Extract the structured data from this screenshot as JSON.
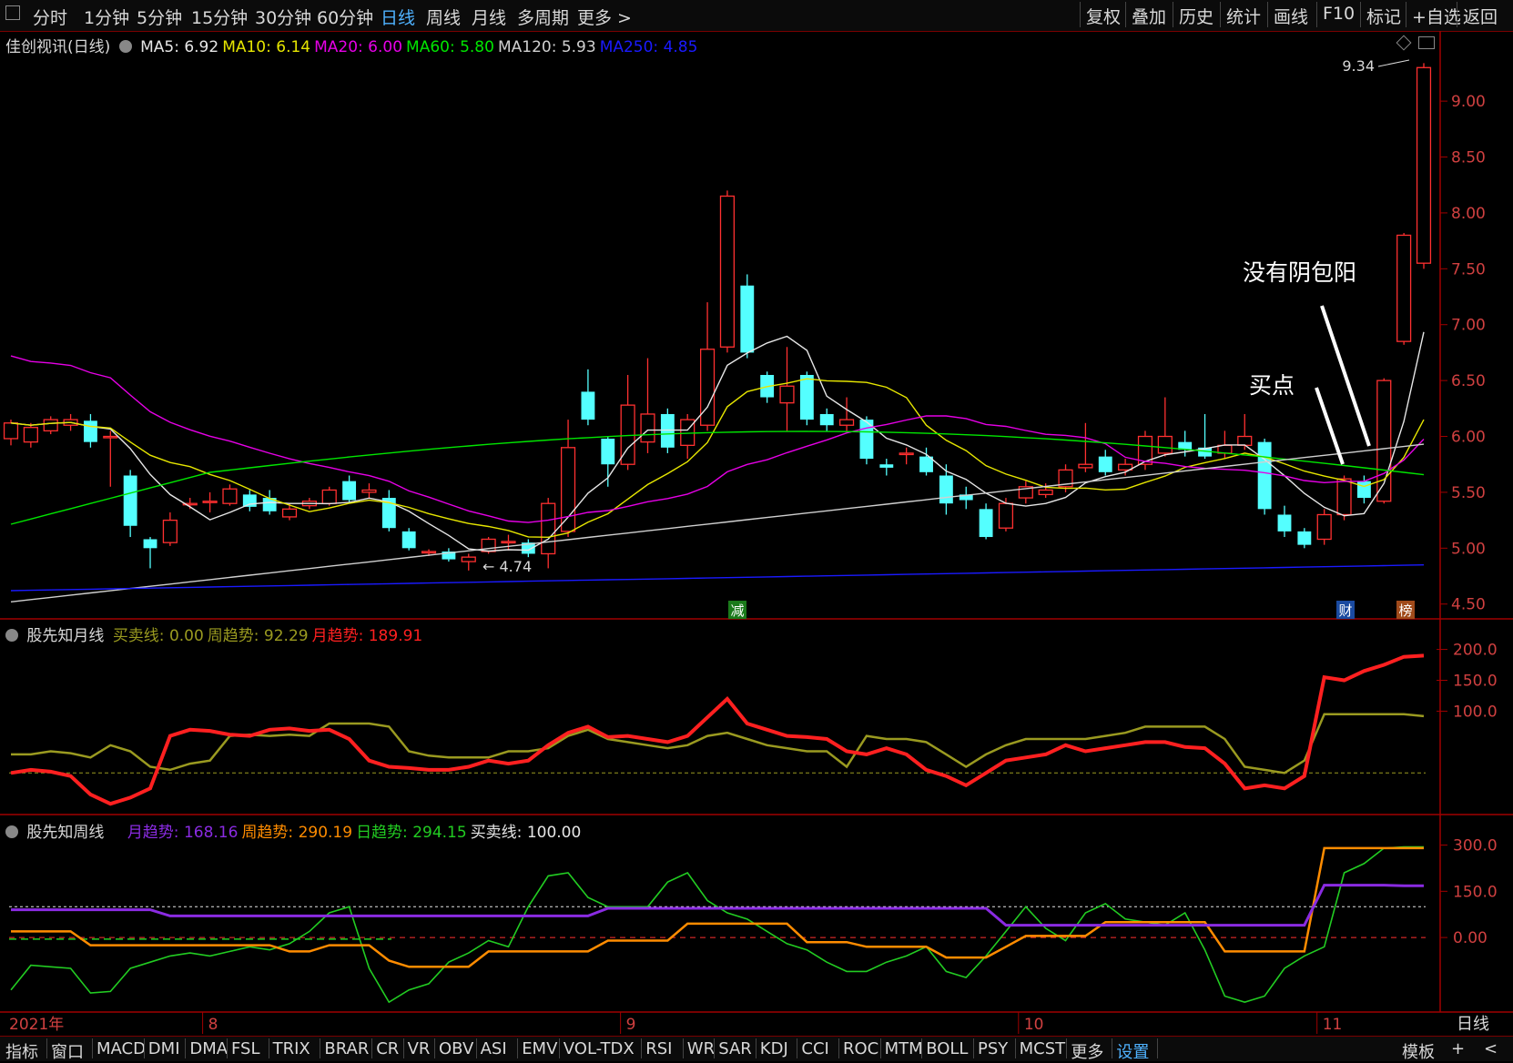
{
  "toolbar": {
    "periods": [
      "分时",
      "1分钟",
      "5分钟",
      "15分钟",
      "30分钟",
      "60分钟",
      "日线",
      "周线",
      "月线",
      "多周期",
      "更多 >"
    ],
    "active_period": "日线",
    "right_buttons": [
      "复权",
      "叠加",
      "历史",
      "统计",
      "画线",
      "F10",
      "标记",
      "+自选",
      "返回"
    ]
  },
  "main_legend": {
    "stock": "佳创视讯(日线)",
    "items": [
      {
        "label": "MA5: 6.92",
        "color": "#e6e6e6"
      },
      {
        "label": "MA10: 6.14",
        "color": "#e6e600"
      },
      {
        "label": "MA20: 6.00",
        "color": "#e600e6"
      },
      {
        "label": "MA60: 5.80",
        "color": "#00e600"
      },
      {
        "label": "MA120: 5.93",
        "color": "#d0d0d0"
      },
      {
        "label": "MA250: 4.85",
        "color": "#1a1aff"
      }
    ]
  },
  "annotations": {
    "no_engulf": "没有阴包阳",
    "buy_point": "买点"
  },
  "markers": {
    "reduce": "减",
    "finance": "财",
    "rank": "榜"
  },
  "price_labels": {
    "high": "9.34",
    "low": "← 4.74"
  },
  "ind1_legend": {
    "name": "股先知月线",
    "items": [
      {
        "label": "买卖线: 0.00",
        "color": "#9a9a20"
      },
      {
        "label": "周趋势: 92.29",
        "color": "#9a9a20"
      },
      {
        "label": "月趋势: 189.91",
        "color": "#ff2020"
      }
    ]
  },
  "ind2_legend": {
    "name": "股先知周线",
    "items": [
      {
        "label": "月趋势: 168.16",
        "color": "#8a2be2"
      },
      {
        "label": "周趋势: 290.19",
        "color": "#ff8c00"
      },
      {
        "label": "日趋势: 294.15",
        "color": "#22cc22"
      },
      {
        "label": "买卖线: 100.00",
        "color": "#e6e6e6"
      }
    ]
  },
  "date_axis": {
    "year": "2021年",
    "months": [
      "8",
      "9",
      "10",
      "11"
    ],
    "period_label": "日线"
  },
  "bottom_tabs": [
    "指标",
    "窗口",
    "MACD",
    "DMI",
    "DMA",
    "FSL",
    "TRIX",
    "BRAR",
    "CR",
    "VR",
    "OBV",
    "ASI",
    "EMV",
    "VOL-TDX",
    "RSI",
    "WR",
    "SAR",
    "KDJ",
    "CCI",
    "ROC",
    "MTM",
    "BOLL",
    "PSY",
    "MCST",
    "更多",
    "设置"
  ],
  "bottom_right": [
    "模板",
    "+",
    "<"
  ],
  "chart_data": [
    {
      "type": "candlestick",
      "title": "佳创视讯(日线)",
      "y_axis_labels": [
        "9.00",
        "8.50",
        "8.00",
        "7.50",
        "7.00",
        "6.50",
        "6.00",
        "5.50",
        "5.00",
        "4.50"
      ],
      "ylim": [
        4.4,
        9.4
      ],
      "candles": [
        [
          5.98,
          6.12,
          6.15,
          5.92
        ],
        [
          5.95,
          6.08,
          6.12,
          5.9
        ],
        [
          6.05,
          6.15,
          6.18,
          6.02
        ],
        [
          6.1,
          6.15,
          6.2,
          6.05
        ],
        [
          6.14,
          5.95,
          6.2,
          5.9
        ],
        [
          6.0,
          6.0,
          6.05,
          5.55
        ],
        [
          5.65,
          5.2,
          5.7,
          5.1
        ],
        [
          5.08,
          5.0,
          5.1,
          4.82
        ],
        [
          5.05,
          5.25,
          5.32,
          5.02
        ],
        [
          5.4,
          5.4,
          5.45,
          5.35
        ],
        [
          5.42,
          5.42,
          5.5,
          5.32
        ],
        [
          5.4,
          5.53,
          5.57,
          5.38
        ],
        [
          5.48,
          5.37,
          5.52,
          5.33
        ],
        [
          5.45,
          5.33,
          5.52,
          5.3
        ],
        [
          5.28,
          5.35,
          5.4,
          5.25
        ],
        [
          5.38,
          5.42,
          5.45,
          5.35
        ],
        [
          5.4,
          5.52,
          5.55,
          5.38
        ],
        [
          5.6,
          5.43,
          5.65,
          5.4
        ],
        [
          5.5,
          5.52,
          5.58,
          5.45
        ],
        [
          5.45,
          5.18,
          5.52,
          5.15
        ],
        [
          5.15,
          5.0,
          5.18,
          4.98
        ],
        [
          4.97,
          4.97,
          4.99,
          4.93
        ],
        [
          4.97,
          4.9,
          5.0,
          4.88
        ],
        [
          4.88,
          4.92,
          4.95,
          4.8
        ],
        [
          4.97,
          5.08,
          5.1,
          4.95
        ],
        [
          5.06,
          5.06,
          5.12,
          4.98
        ],
        [
          5.05,
          4.95,
          5.08,
          4.92
        ],
        [
          4.95,
          5.4,
          5.45,
          4.82
        ],
        [
          5.15,
          5.9,
          6.15,
          5.1
        ],
        [
          6.4,
          6.15,
          6.6,
          6.1
        ],
        [
          5.98,
          5.75,
          6.0,
          5.55
        ],
        [
          5.75,
          6.28,
          6.55,
          5.7
        ],
        [
          5.95,
          6.2,
          6.7,
          5.85
        ],
        [
          6.2,
          5.9,
          6.25,
          5.85
        ],
        [
          5.92,
          6.15,
          6.2,
          5.8
        ],
        [
          6.1,
          6.78,
          7.2,
          6.05
        ],
        [
          6.8,
          8.15,
          8.2,
          6.75
        ],
        [
          7.35,
          6.75,
          7.45,
          6.7
        ],
        [
          6.55,
          6.35,
          6.58,
          6.3
        ],
        [
          6.3,
          6.45,
          6.8,
          6.05
        ],
        [
          6.55,
          6.15,
          6.58,
          6.1
        ],
        [
          6.2,
          6.1,
          6.25,
          6.05
        ],
        [
          6.1,
          6.15,
          6.35,
          6.05
        ],
        [
          6.15,
          5.8,
          6.18,
          5.75
        ],
        [
          5.75,
          5.72,
          5.8,
          5.65
        ],
        [
          5.85,
          5.85,
          5.9,
          5.75
        ],
        [
          5.82,
          5.68,
          5.9,
          5.65
        ],
        [
          5.65,
          5.4,
          5.75,
          5.3
        ],
        [
          5.48,
          5.43,
          5.55,
          5.35
        ],
        [
          5.35,
          5.1,
          5.4,
          5.08
        ],
        [
          5.18,
          5.4,
          5.45,
          5.15
        ],
        [
          5.45,
          5.55,
          5.6,
          5.4
        ],
        [
          5.48,
          5.52,
          5.58,
          5.45
        ],
        [
          5.55,
          5.7,
          5.75,
          5.5
        ],
        [
          5.72,
          5.75,
          6.12,
          5.68
        ],
        [
          5.82,
          5.68,
          5.88,
          5.65
        ],
        [
          5.7,
          5.75,
          5.8,
          5.65
        ],
        [
          5.75,
          6.0,
          6.05,
          5.7
        ],
        [
          5.85,
          6.0,
          6.35,
          5.82
        ],
        [
          5.95,
          5.88,
          6.05,
          5.82
        ],
        [
          5.9,
          5.82,
          6.2,
          5.8
        ],
        [
          5.85,
          5.92,
          6.05,
          5.8
        ],
        [
          5.92,
          6.0,
          6.2,
          5.88
        ],
        [
          5.95,
          5.35,
          5.98,
          5.3
        ],
        [
          5.3,
          5.15,
          5.38,
          5.1
        ],
        [
          5.15,
          5.03,
          5.18,
          5.0
        ],
        [
          5.08,
          5.3,
          5.35,
          5.03
        ],
        [
          5.3,
          5.62,
          5.65,
          5.25
        ],
        [
          5.6,
          5.45,
          5.65,
          5.4
        ],
        [
          5.42,
          6.5,
          6.52,
          5.4
        ],
        [
          6.85,
          7.8,
          7.82,
          6.82
        ],
        [
          7.55,
          9.3,
          9.34,
          7.5
        ]
      ]
    },
    {
      "type": "line",
      "title": "股先知月线",
      "y_axis_labels": [
        "200.0",
        "150.0",
        "100.0"
      ],
      "ylim": [
        -60,
        220
      ],
      "series": [
        {
          "name": "月趋势",
          "color": "#ff2020",
          "values": [
            0,
            5,
            2,
            -5,
            -35,
            -50,
            -40,
            -25,
            60,
            70,
            68,
            62,
            60,
            70,
            72,
            68,
            70,
            55,
            20,
            10,
            8,
            5,
            5,
            10,
            20,
            15,
            20,
            45,
            65,
            75,
            58,
            60,
            55,
            50,
            60,
            90,
            120,
            80,
            70,
            60,
            58,
            55,
            35,
            30,
            40,
            30,
            5,
            -5,
            -20,
            0,
            20,
            25,
            30,
            45,
            35,
            40,
            45,
            50,
            50,
            42,
            40,
            15,
            -25,
            -20,
            -25,
            -5,
            155,
            150,
            165,
            175,
            188,
            190
          ]
        },
        {
          "name": "周趋势",
          "color": "#9a9a20",
          "values": [
            30,
            30,
            35,
            32,
            25,
            45,
            35,
            10,
            5,
            15,
            20,
            60,
            62,
            60,
            62,
            60,
            80,
            80,
            80,
            75,
            35,
            28,
            25,
            25,
            25,
            35,
            35,
            40,
            60,
            70,
            55,
            50,
            45,
            40,
            45,
            60,
            65,
            55,
            45,
            40,
            35,
            35,
            10,
            60,
            55,
            55,
            50,
            30,
            10,
            30,
            45,
            55,
            55,
            55,
            55,
            60,
            65,
            75,
            75,
            75,
            75,
            55,
            10,
            5,
            0,
            20,
            95,
            95,
            95,
            95,
            95,
            92
          ]
        },
        {
          "name": "买卖线",
          "color": "#9a9a20",
          "values": [
            0,
            0
          ]
        }
      ]
    },
    {
      "type": "line",
      "title": "股先知周线",
      "y_axis_labels": [
        "300.0",
        "150.0",
        "0.00"
      ],
      "ylim": [
        -230,
        340
      ],
      "series": [
        {
          "name": "月趋势",
          "color": "#8a2be2",
          "values": [
            90,
            90,
            90,
            90,
            90,
            90,
            90,
            90,
            70,
            70,
            70,
            70,
            70,
            70,
            70,
            70,
            70,
            70,
            70,
            70,
            70,
            70,
            70,
            70,
            70,
            70,
            70,
            70,
            70,
            70,
            95,
            95,
            95,
            95,
            95,
            95,
            95,
            95,
            95,
            95,
            95,
            95,
            95,
            95,
            95,
            95,
            95,
            95,
            95,
            95,
            40,
            40,
            40,
            40,
            40,
            40,
            40,
            40,
            40,
            40,
            40,
            40,
            40,
            40,
            40,
            40,
            170,
            170,
            170,
            170,
            168,
            168
          ]
        },
        {
          "name": "周趋势",
          "color": "#ff8c00",
          "values": [
            20,
            20,
            20,
            20,
            -25,
            -25,
            -25,
            -25,
            -25,
            -25,
            -25,
            -25,
            -25,
            -25,
            -45,
            -45,
            -25,
            -25,
            -25,
            -75,
            -95,
            -95,
            -95,
            -95,
            -45,
            -45,
            -45,
            -45,
            -45,
            -45,
            -10,
            -10,
            -10,
            -10,
            45,
            45,
            45,
            45,
            45,
            45,
            -15,
            -15,
            -15,
            -30,
            -30,
            -30,
            -30,
            -65,
            -65,
            -65,
            -30,
            5,
            5,
            5,
            5,
            50,
            50,
            50,
            50,
            50,
            50,
            -45,
            -45,
            -45,
            -45,
            -45,
            290,
            290,
            290,
            290,
            290,
            290
          ]
        },
        {
          "name": "日趋势",
          "color": "#22cc22",
          "values": [
            -170,
            -90,
            -95,
            -100,
            -180,
            -175,
            -100,
            -80,
            -60,
            -50,
            -60,
            -45,
            -30,
            -40,
            -20,
            20,
            80,
            100,
            -100,
            -210,
            -170,
            -150,
            -80,
            -50,
            -10,
            -30,
            100,
            200,
            210,
            130,
            100,
            100,
            100,
            180,
            210,
            120,
            80,
            60,
            20,
            -20,
            -40,
            -80,
            -110,
            -110,
            -80,
            -60,
            -30,
            -110,
            -130,
            -60,
            20,
            100,
            30,
            -10,
            80,
            110,
            60,
            50,
            40,
            80,
            -40,
            -190,
            -210,
            -190,
            -100,
            -60,
            -30,
            210,
            240,
            290,
            294,
            294
          ]
        },
        {
          "name": "买卖线",
          "color": "#e6e6e6",
          "values": [
            100,
            100
          ]
        }
      ]
    }
  ]
}
